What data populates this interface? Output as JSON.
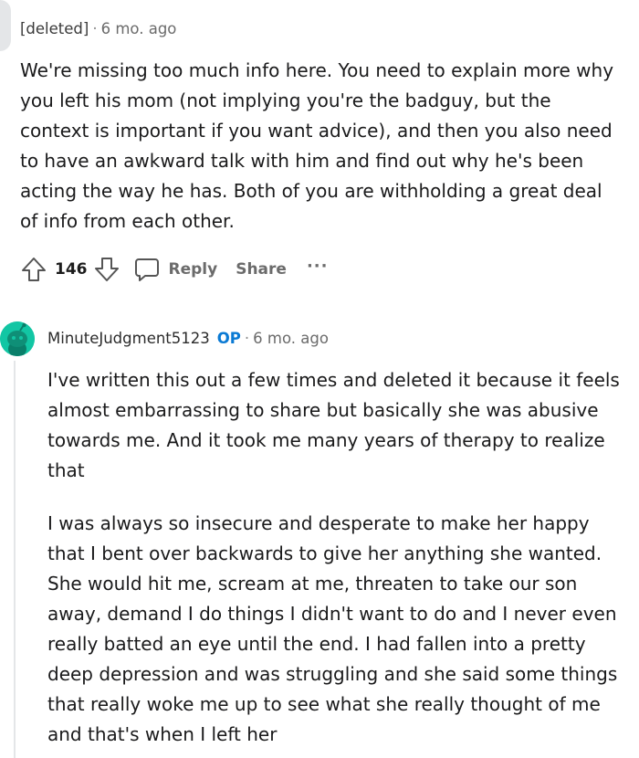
{
  "comment1": {
    "author": "[deleted]",
    "separator": "·",
    "time": "6 mo. ago",
    "body": "We're missing too much info here. You need to explain more why you left his mom (not implying you're the badguy, but the context is important if you want advice), and then you also need to have an awkward talk with him and find out why he's been acting the way he has. Both of you are withholding a great deal of info from each other.",
    "score": "146",
    "actions": {
      "reply": "Reply",
      "share": "Share",
      "more": "···"
    }
  },
  "comment2": {
    "author": "MinuteJudgment5123",
    "badge": "OP",
    "separator": "·",
    "time": "6 mo. ago",
    "paragraphs": [
      "I've written this out a few times and deleted it because it feels almost embarrassing to share but basically she was abusive towards me. And it took me many years of therapy to realize that",
      "I was always so insecure and desperate to make her happy that I bent over backwards to give her anything she wanted. She would hit me, scream at me, threaten to take our son away, demand I do things I didn't want to do and I never even really batted an eye until the end. I had fallen into a pretty deep depression and was struggling and she said some things that really woke me up to see what she really thought of me and that's when I left her"
    ]
  },
  "icons": {
    "upvote": "upvote-arrow-icon",
    "downvote": "downvote-arrow-icon",
    "reply": "speech-bubble-icon",
    "avatar": "snoo-avatar-icon"
  },
  "colors": {
    "op_badge": "#0a7ad4",
    "avatar_bg": "#12c6a4",
    "meta_text": "#6b6b6b",
    "thread_line": "#e4e6e8"
  }
}
